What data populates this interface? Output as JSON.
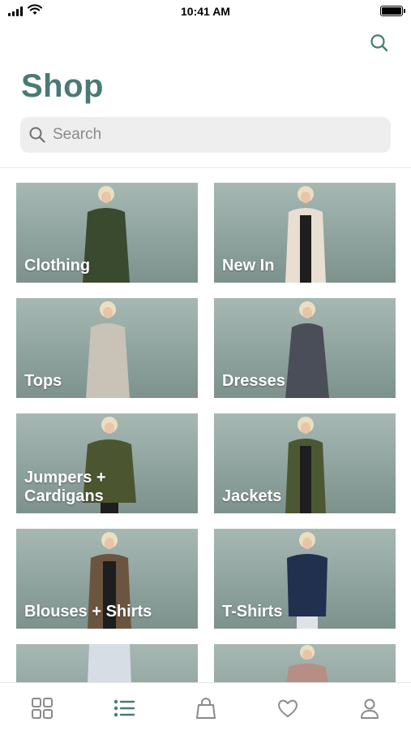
{
  "status_bar": {
    "time": "10:41 AM"
  },
  "header": {
    "title": "Shop"
  },
  "search": {
    "placeholder": "Search",
    "value": ""
  },
  "categories": [
    {
      "label": "Clothing",
      "outfit_color": "#3a4a2e"
    },
    {
      "label": "New In",
      "outfit_color": "#e8ded2"
    },
    {
      "label": "Tops",
      "outfit_color": "#c9c2b6"
    },
    {
      "label": "Dresses",
      "outfit_color": "#4a4e58"
    },
    {
      "label": "Jumpers +\nCardigans",
      "outfit_color": "#4b5631"
    },
    {
      "label": "Jackets",
      "outfit_color": "#4b5833"
    },
    {
      "label": "Blouses + Shirts",
      "outfit_color": "#6b5540"
    },
    {
      "label": "T-Shirts",
      "outfit_color": "#22304f"
    },
    {
      "label": "",
      "outfit_color": "#d7dde5"
    },
    {
      "label": "",
      "outfit_color": "#b58f86"
    }
  ],
  "tab_bar": {
    "items": [
      {
        "icon": "grid-icon",
        "active": false
      },
      {
        "icon": "list-icon",
        "active": true
      },
      {
        "icon": "bag-icon",
        "active": false
      },
      {
        "icon": "heart-icon",
        "active": false
      },
      {
        "icon": "profile-icon",
        "active": false
      }
    ]
  },
  "colors": {
    "accent": "#4a7a74",
    "inactive_icon": "#8a8a8a"
  }
}
